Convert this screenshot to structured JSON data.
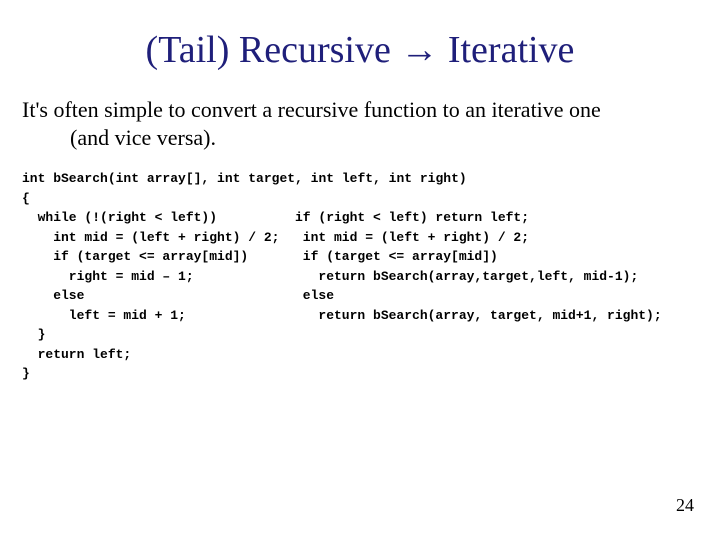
{
  "title_left": "(Tail) Recursive ",
  "title_arrow": "→",
  "title_right": " Iterative",
  "intro_line1": "It's often simple to convert a recursive function to an iterative one",
  "intro_line2": "(and vice versa).",
  "code": {
    "iterative": "int bSearch(int array[], int target, int left, int right)\n{\n  while (!(right < left))\n    int mid = (left + right) / 2;\n    if (target <= array[mid])\n      right = mid – 1;\n    else\n      left = mid + 1;\n  }\n  return left;\n}",
    "recursive": "if (right < left) return left;\n int mid = (left + right) / 2;\n if (target <= array[mid])\n   return bSearch(array,target,left, mid-1);\n else\n   return bSearch(array, target, mid+1, right);"
  },
  "page_number": "24"
}
